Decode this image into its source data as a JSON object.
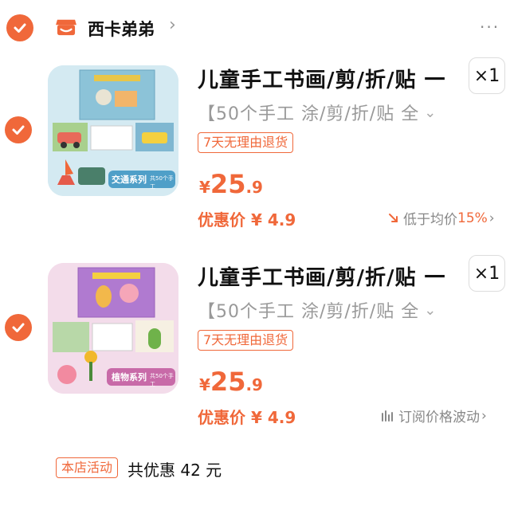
{
  "shop": {
    "name": "西卡弟弟",
    "chevron": "›",
    "more": "···"
  },
  "items": [
    {
      "thumb_caption": "交通系列",
      "thumb_sub": "共50个手工",
      "title": "儿童手工书画/剪/折/贴 一",
      "qty": "×1",
      "spec": "【50个手工 涂/剪/折/贴 全",
      "spec_arrow": "⌄",
      "badge": "7天无理由退货",
      "price_currency": "¥",
      "price_int": "25",
      "price_dec": ".9",
      "promo": "优惠价 ¥ 4.9",
      "note_prefix": "低于均价",
      "note_pct": "15%",
      "note_suffix": "›",
      "note_icon": "trend-down-icon",
      "thumb_bg": "#cfe6ee",
      "caption_bg": "#4f9fc8"
    },
    {
      "thumb_caption": "植物系列",
      "thumb_sub": "共50个手工",
      "title": "儿童手工书画/剪/折/贴 一",
      "qty": "×1",
      "spec": "【50个手工 涂/剪/折/贴 全",
      "spec_arrow": "⌄",
      "badge": "7天无理由退货",
      "price_currency": "¥",
      "price_int": "25",
      "price_dec": ".9",
      "promo": "优惠价 ¥ 4.9",
      "note_text": "订阅价格波动",
      "note_suffix": "›",
      "note_icon": "price-chart-icon",
      "thumb_bg": "#f1d6e6",
      "caption_bg": "#c86aa8"
    }
  ],
  "activity": {
    "tag": "本店活动",
    "text": "共优惠 42 元"
  },
  "colors": {
    "accent": "#f0683a",
    "muted": "#999999"
  }
}
